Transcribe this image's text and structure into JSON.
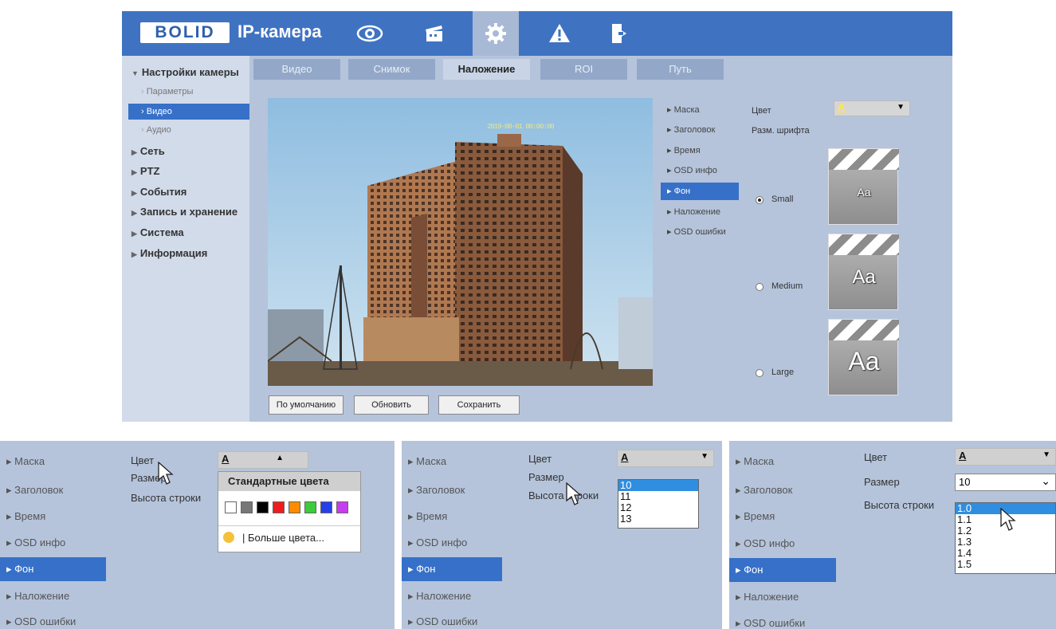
{
  "header": {
    "logo": "BOLID",
    "title": "IP-камера"
  },
  "top_icons": [
    "eye-icon",
    "clapper-icon",
    "gear-icon",
    "warning-icon",
    "exit-icon"
  ],
  "sidebar": {
    "camera_settings": "Настройки камеры",
    "sub_items": [
      "Параметры",
      "Видео",
      "Аудио"
    ],
    "sections": [
      "Сеть",
      "PTZ",
      "События",
      "Запись и хранение",
      "Система",
      "Информация"
    ]
  },
  "tabs": [
    "Видео",
    "Снимок",
    "Наложение",
    "ROI",
    "Путь"
  ],
  "overlay_options": [
    "Маска",
    "Заголовок",
    "Время",
    "OSD инфо",
    "Фон",
    "Наложение",
    "OSD ошибки"
  ],
  "preview": {
    "timestamp": "2019-08-01 00:00:00"
  },
  "right_panel": {
    "color_label": "Цвет",
    "color_value": "A",
    "font_size_label": "Разм. шрифта",
    "sizes": [
      "Small",
      "Medium",
      "Large"
    ],
    "sample": "Aa"
  },
  "buttons": {
    "default": "По умолчанию",
    "refresh": "Обновить",
    "save": "Сохранить"
  },
  "panel1": {
    "color": "Цвет",
    "size": "Размер",
    "line_height": "Высота строки",
    "color_value": "A",
    "popup_title": "Стандартные цвета",
    "swatches": [
      "#ffffff",
      "#777777",
      "#000000",
      "#ee1c1c",
      "#ff8c00",
      "#3bcc3b",
      "#2540e8",
      "#c83cf0"
    ],
    "more": "| Больше цвета..."
  },
  "panel2": {
    "color": "Цвет",
    "size": "Размер",
    "line_height": "Высота строки",
    "color_value": "A",
    "size_options": [
      "10",
      "11",
      "12",
      "13"
    ]
  },
  "panel3": {
    "color": "Цвет",
    "size": "Размер",
    "line_height": "Высота строки",
    "color_value": "A",
    "size_value": "10",
    "line_options": [
      "1.0",
      "1.1",
      "1.2",
      "1.3",
      "1.4",
      "1.5"
    ]
  }
}
